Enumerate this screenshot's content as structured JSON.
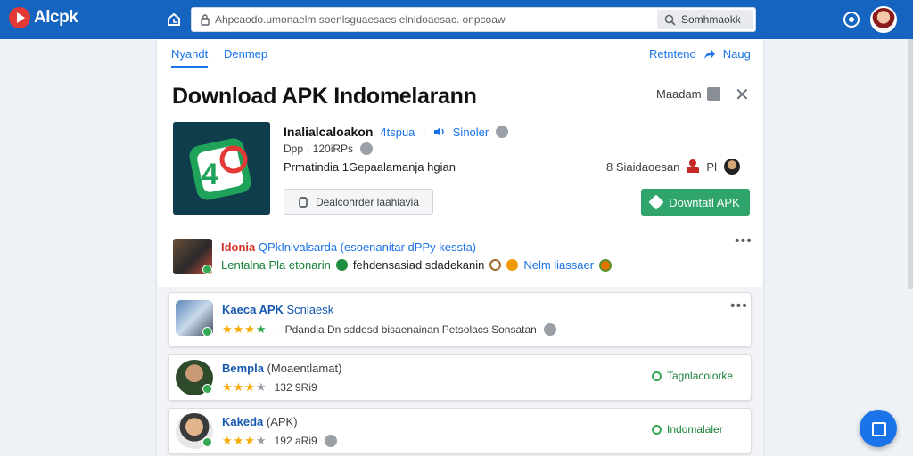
{
  "topbar": {
    "logo_text": "Alcpk",
    "search_text": "Ahpcaodo.umonaelm soenlsguaesaes elnldoaesac. onpcoaw",
    "search_button": "Somhmaokk"
  },
  "tabs": {
    "primary": "Nyandt",
    "secondary": "Denmep",
    "right_label": "Retnteno",
    "right_link": "Naug"
  },
  "header": {
    "title": "Download APK Indomelarann",
    "action_label": "Maadam"
  },
  "app": {
    "name": "Inalialcaloakon",
    "downloads": "4tspua",
    "developer": "Sinoler",
    "specs": "Dpp · 120iRPs",
    "description": "Prmatindia 1Gepaalamanja hgian",
    "rank": "8 Siaidaoesan",
    "rank_tag": "Pl",
    "secondary_button": "Dealcohrder laahlavia",
    "primary_button": "Downtatl APK"
  },
  "feature": {
    "title_red": "Idonia",
    "title_rest": "QPkInlvalsarda (esoenanitar dPPy kessta)",
    "sub_green": "Lentalna Pla etonarin",
    "sub_mid": "fehdensasiad sdadekanin",
    "sub_blue": "Nelm liassaer"
  },
  "cards": [
    {
      "title": "Kaeca APK",
      "title_rest": "Scnlaesk",
      "stars": "★★★",
      "stars_off": "",
      "meta": "Pdandia Dn sddesd bisaenainan Petsolacs Sonsatan",
      "action": ""
    },
    {
      "title": "Bempla",
      "title_rest": "(Moaentlamat)",
      "stars": "★★★",
      "stars_off": "",
      "meta": "132 9Ri9",
      "action": "Tagnlacolorke"
    },
    {
      "title": "Kakeda",
      "title_rest": "(APK)",
      "stars": "★★★",
      "stars_off": "",
      "meta": "192 aRi9",
      "action": "Indomalaler"
    }
  ],
  "colors": {
    "topbar": "#1565c0",
    "primary_button": "#2fa46b",
    "link": "#1a73e8"
  }
}
